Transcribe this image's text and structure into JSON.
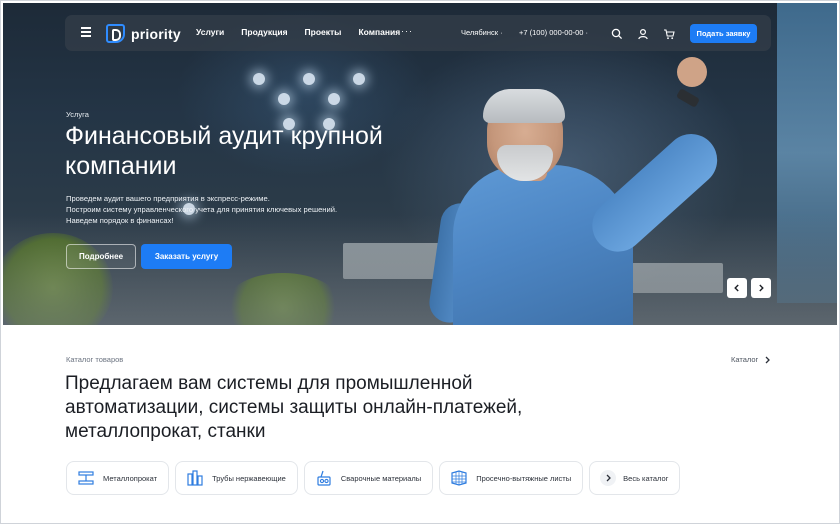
{
  "header": {
    "logo_text": "priority",
    "menu": [
      "Услуги",
      "Продукция",
      "Проекты",
      "Компания"
    ],
    "more": "···",
    "city": "Челябинск ·",
    "phone": "+7 (100) 000-00-00 ·",
    "cta_label": "Подать заявку",
    "icons": [
      "menu-icon",
      "search-icon",
      "user-icon",
      "cart-icon"
    ]
  },
  "hero": {
    "eyebrow": "Услуга",
    "title": "Финансовый аудит крупной компании",
    "description": [
      "Проведем аудит вашего предприятия в экспресс-режиме.",
      "Построим систему управленческого учета для принятия ключевых решений.",
      "Наведем порядок в финансах!"
    ],
    "btn_more": "Подробнее",
    "btn_order": "Заказать услугу",
    "slider_prev": "‹",
    "slider_next": "›"
  },
  "catalog": {
    "eyebrow": "Каталог товаров",
    "link": "Каталог",
    "title": "Предлагаем вам системы для промышленной автоматизации, системы защиты онлайн-платежей, металлопрокат, станки",
    "chips": [
      {
        "label": "Металлопрокат",
        "icon": "metal-icon"
      },
      {
        "label": "Трубы нержавеющие",
        "icon": "pipes-icon"
      },
      {
        "label": "Сварочные материалы",
        "icon": "welding-icon"
      },
      {
        "label": "Просечно-вытяжные листы",
        "icon": "mesh-icon"
      },
      {
        "label": "Весь каталог",
        "icon": "arrow-right-icon"
      }
    ]
  },
  "colors": {
    "accent": "#1d7cf5",
    "nav_bg": "#343e4a"
  }
}
